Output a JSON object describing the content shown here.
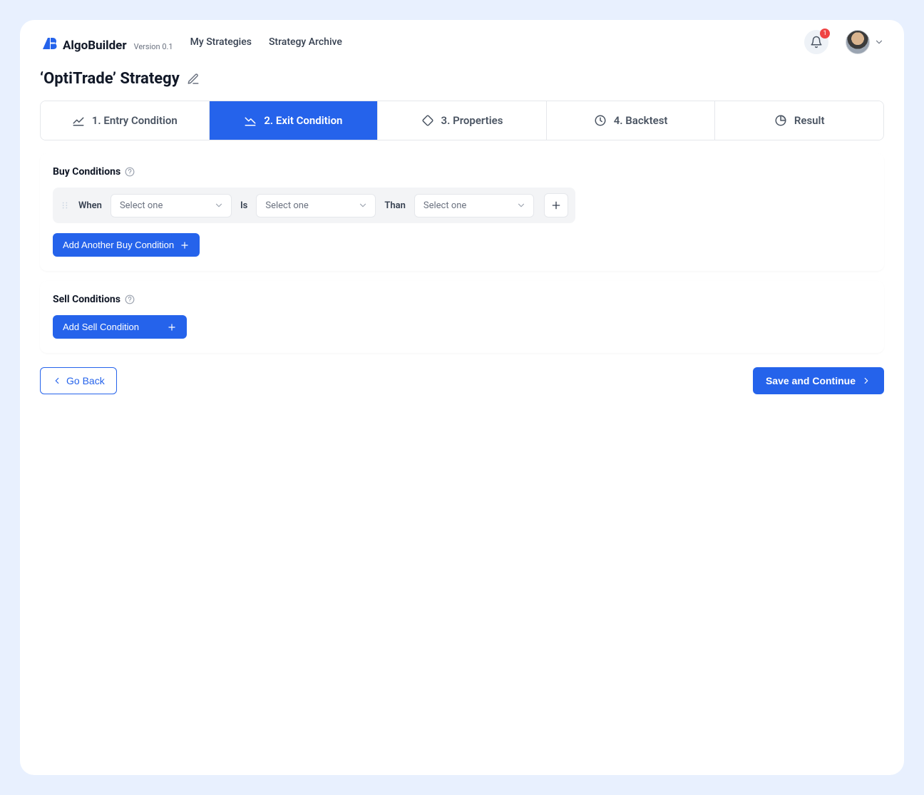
{
  "header": {
    "app_name": "AlgoBuilder",
    "version": "Version 0.1",
    "nav": {
      "my_strategies": "My Strategies",
      "archive": "Strategy Archive"
    },
    "notification_count": "1"
  },
  "page": {
    "title": "‘OptiTrade’ Strategy"
  },
  "tabs": {
    "t1": "1.  Entry Condition",
    "t2": "2.  Exit Condition",
    "t3": "3.  Properties",
    "t4": "4.  Backtest",
    "t5": "Result",
    "active_index": 1
  },
  "buy": {
    "section_title": "Buy Conditions",
    "row": {
      "when_label": "When",
      "when_placeholder": "Select one",
      "is_label": "Is",
      "is_placeholder": "Select one",
      "than_label": "Than",
      "than_placeholder": "Select one"
    },
    "add_btn": "Add Another Buy Condition"
  },
  "sell": {
    "section_title": "Sell Conditions",
    "add_btn": "Add Sell Condition"
  },
  "footer": {
    "back": "Go Back",
    "save": "Save and Continue"
  }
}
